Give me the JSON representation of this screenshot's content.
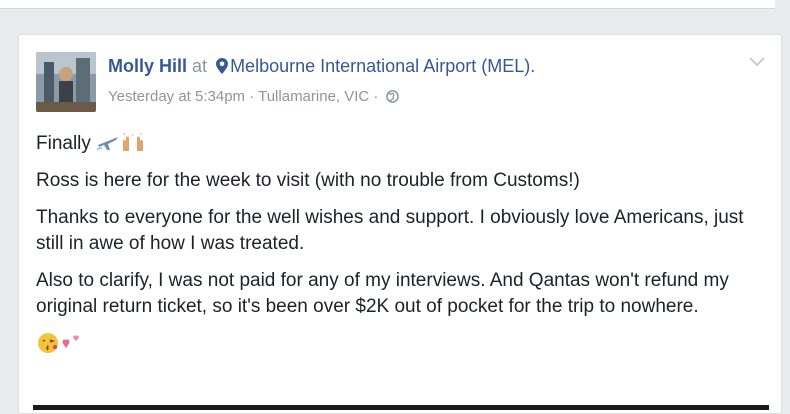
{
  "post": {
    "author": "Molly Hill",
    "at_word": "at",
    "location": "Melbourne International Airport (MEL).",
    "timestamp": "Yesterday at 5:34pm",
    "meta_separator": " · ",
    "place": "Tullamarine, VIC",
    "meta_separator_2": " · ",
    "lines": {
      "finally": "Finally",
      "ross": "Ross is here for the week to visit (with no trouble from Customs!)",
      "thanks": "Thanks to everyone for the well wishes and support. I obviously love Americans, just still in awe of how I was treated.",
      "clarify": "Also to clarify, I was not paid for any of my interviews. And Qantas won't refund my original return ticket, so it's been over $2K out of pocket for the trip to nowhere."
    }
  },
  "icons": {
    "location_pin": "map-pin-icon",
    "privacy": "globe-icon",
    "options": "chevron-down-icon",
    "emoji_1": "airplane-emoji",
    "emoji_2": "raised-hands-emoji",
    "emoji_3": "kissing-face-emoji",
    "emoji_4": "two-hearts-emoji"
  },
  "colors": {
    "link_blue": "#365899",
    "meta_gray": "#90949c",
    "text_dark": "#1d2129",
    "background": "#e9ebee"
  }
}
